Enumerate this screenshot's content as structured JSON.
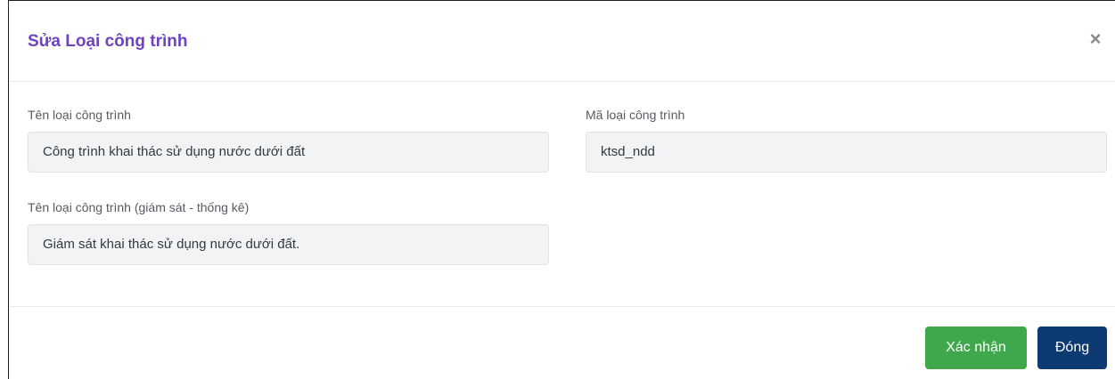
{
  "dialog": {
    "title": "Sửa Loại công trình",
    "close_symbol": "×",
    "close_icon": "close-icon"
  },
  "form": {
    "name": {
      "label": "Tên loại công trình",
      "value": "Công trình khai thác sử dụng nước dưới đất"
    },
    "code": {
      "label": "Mã loại công trình",
      "value": "ktsd_ndd"
    },
    "monitoring_name": {
      "label": "Tên loại công trình (giám sát - thống kê)",
      "value": "Giám sát khai thác sử dụng nước dưới đất."
    }
  },
  "footer": {
    "confirm_label": "Xác nhận",
    "close_label": "Đóng"
  },
  "colors": {
    "title": "#6f42c1",
    "confirm": "#40a84c",
    "close": "#0d3a72",
    "input_bg": "#f1f3f5"
  }
}
